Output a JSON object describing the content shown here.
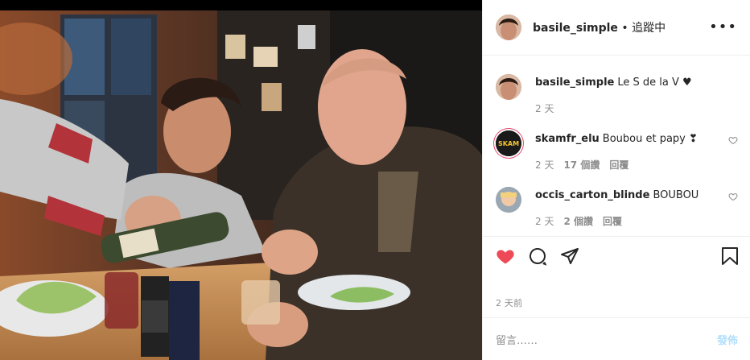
{
  "post": {
    "username": "basile_simple",
    "follow_status": " • 追蹤中",
    "more": "•••"
  },
  "comments": [
    {
      "user": "basile_simple",
      "text": "Le S de la V ♥",
      "time": "2 天",
      "likes": "",
      "reply": ""
    },
    {
      "user": "skamfr_elu",
      "text": "Boubou et papy ❣",
      "time": "2 天",
      "likes": "17 個讚",
      "reply": "回覆",
      "avatar_text": "SKAM"
    },
    {
      "user": "occis_carton_blinde",
      "text": "BOUBOU",
      "time": "2 天",
      "likes": "2 個讚",
      "reply": "回覆"
    }
  ],
  "timestamp": "2 天前",
  "add_comment": {
    "placeholder": "留言……",
    "post_label": "發佈"
  },
  "colors": {
    "like_red": "#ed4956",
    "text": "#262626",
    "muted": "#8e8e8e",
    "post_blue": "#b2dffc"
  },
  "icons": [
    "heart-icon",
    "comment-icon",
    "share-icon",
    "bookmark-icon",
    "more-icon"
  ]
}
